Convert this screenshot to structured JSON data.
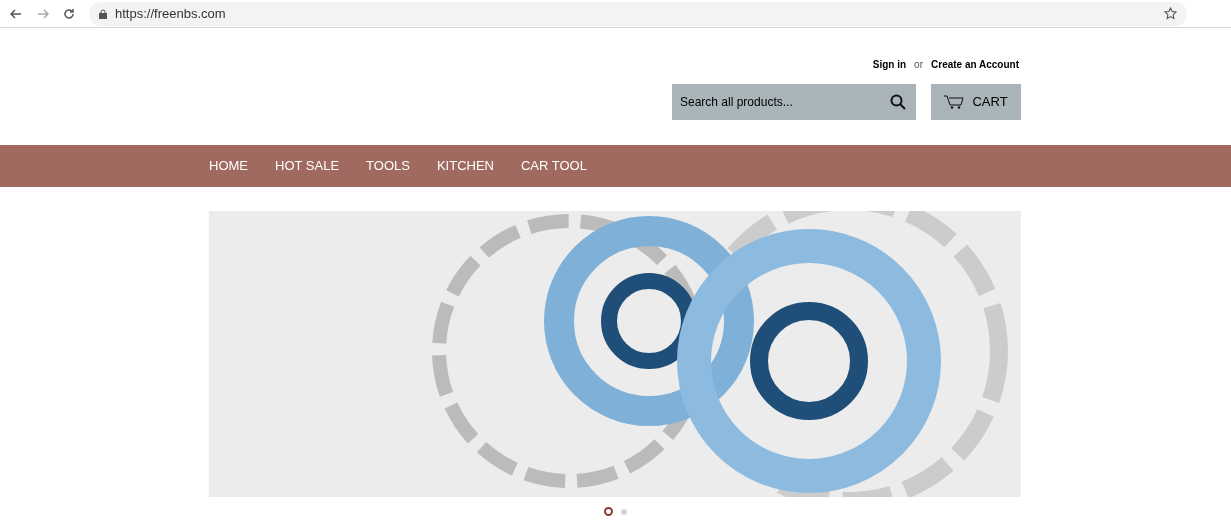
{
  "browser": {
    "url": "https://freenbs.com"
  },
  "header": {
    "sign_in": "Sign in",
    "separator": "or",
    "create_account": "Create an Account",
    "search": {
      "placeholder": "Search all products..."
    },
    "cart": "CART"
  },
  "nav": [
    {
      "label": "HOME"
    },
    {
      "label": "HOT SALE"
    },
    {
      "label": "TOOLS"
    },
    {
      "label": "KITCHEN"
    },
    {
      "label": "CAR TOOL"
    }
  ],
  "slider": {
    "dots": [
      {
        "selected": true
      },
      {
        "selected": false
      }
    ]
  }
}
